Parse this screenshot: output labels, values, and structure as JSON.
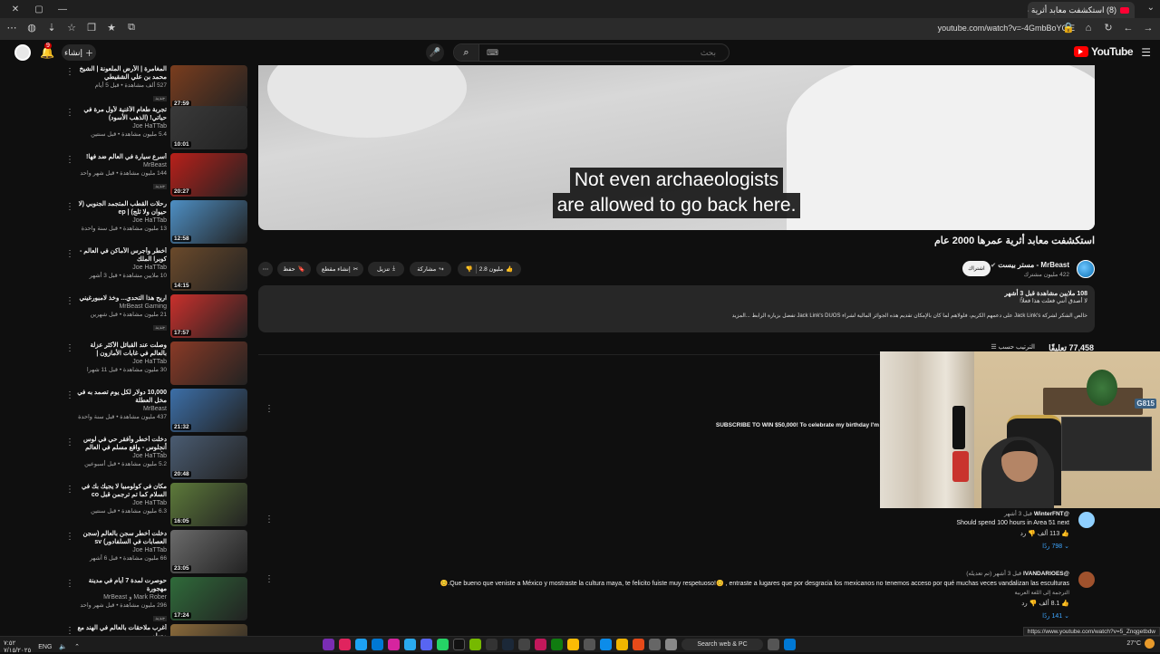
{
  "browser": {
    "tab_title": "(8) استكشفت معابد أثرية عمرها",
    "url": "youtube.com/watch?v=-4GmbBoYCjE",
    "status_url": "https://www.youtube.com/watch?v=5_Znqgetbdw"
  },
  "header": {
    "create_label": "إنشاء",
    "search_placeholder": "بحث",
    "notif_count": "9",
    "logo_text": "YouTube"
  },
  "related": [
    {
      "title": "المغامرة | الأرض الملعونة | الشيخ محمد بن علي الشقيطي",
      "channel": "",
      "meta": "527 ألف مشاهدة • قبل 5 أيام",
      "duration": "27:59",
      "new": "جديد",
      "thumb_color": "#7a3d1e"
    },
    {
      "title": "تجربة طعام الأغنية لأول مرة في حياتي! (الذهب الأسود)",
      "channel": "Joe HaTTab",
      "meta": "5.4 مليون مشاهدة • قبل سنتين",
      "duration": "10:01",
      "new": "",
      "thumb_color": "#3a3a3a"
    },
    {
      "title": "أسرع سيارة في العالم ضد فها!",
      "channel": "MrBeast",
      "meta": "144 مليون مشاهدة • قبل شهر واحد",
      "duration": "20:27",
      "new": "جديد",
      "thumb_color": "#b8201a"
    },
    {
      "title": "رحلات القطب المتجمد الجنوبي (لا حيوان ولا ثلج) | ep",
      "channel": "Joe HaTTab",
      "meta": "13 مليون مشاهدة • قبل سنة واحدة",
      "duration": "12:58",
      "new": "",
      "thumb_color": "#4e8fc4"
    },
    {
      "title": "أخطر وأجرس الأماكن في العالم - كوبرا الملك",
      "channel": "Joe HaTTab",
      "meta": "10 ملايين مشاهدة • قبل 3 أشهر",
      "duration": "14:15",
      "new": "",
      "thumb_color": "#6b4a2b"
    },
    {
      "title": "اربح هذا التحدي... وخذ لامبورغيني",
      "channel": "MrBeast Gaming",
      "meta": "21 مليون مشاهدة • قبل شهرين",
      "duration": "17:57",
      "new": "جديد",
      "thumb_color": "#c9302c"
    },
    {
      "title": "وصلت عند القبائل الأكثر عزلة بالعالم في غابات الأمازون | Waorani Tribe",
      "channel": "Joe HaTTab",
      "meta": "30 مليون مشاهدة • قبل 11 شهرا",
      "duration": "",
      "new": "",
      "thumb_color": "#8a3a26"
    },
    {
      "title": "10,000 دولار لكل يوم تصمد به في مخل العطلة",
      "channel": "MrBeast",
      "meta": "437 مليون مشاهدة • قبل سنة واحدة",
      "duration": "21:32",
      "new": "",
      "thumb_color": "#3c6fa8"
    },
    {
      "title": "دخلت أخطر وأفقر حي في لوس أنجلوس - واقع مسلم في العالم الأمريكي us",
      "channel": "Joe HaTTab",
      "meta": "5.2 مليون مشاهدة • قبل أسبوعين",
      "duration": "20:48",
      "new": "",
      "thumb_color": "#4a5c72"
    },
    {
      "title": "مكان في كولومبيا لا يجيك بك في السلام كما تم ترجمن قبل co",
      "channel": "Joe HaTTab",
      "meta": "6.3 مليون مشاهدة • قبل سنتين",
      "duration": "16:05",
      "new": "",
      "thumb_color": "#5d7a3a"
    },
    {
      "title": "دخلت أخطر سجن بالعالم (سجن العصابات في السلفادور) sv CECOT",
      "channel": "Joe HaTTab",
      "meta": "66 مليون مشاهدة • قبل 6 أشهر",
      "duration": "23:05",
      "new": "",
      "thumb_color": "#6b6b6b"
    },
    {
      "title": "حوصرت لمدة 7 أيام في مدينة مهجورة",
      "channel": "Mark Rober و MrBeast",
      "meta": "296 مليون مشاهدة • قبل شهر واحد",
      "duration": "17:24",
      "new": "جديد",
      "thumb_color": "#2f6b3a"
    },
    {
      "title": "أغرب ملاحقات بالعالم في الهند مع مسلم",
      "channel": "",
      "meta": "",
      "duration": "",
      "new": "",
      "thumb_color": "#8a6a3a"
    }
  ],
  "video": {
    "subtitle_line1": "Not even archaeologists",
    "subtitle_line2": "are allowed to go back here.",
    "title": "استكشفت معابد أثرية عمرها 2000 عام",
    "tag": "",
    "channel": "MrBeast - مستر بيست",
    "subs": "422 مليون مشترك",
    "subscribe_label": "اشتراك",
    "likes": "2.8 مليون",
    "share_label": "مشاركة",
    "download_label": "تنزيل",
    "clip_label": "إنشاء مقطع",
    "save_label": "حفظ"
  },
  "description": {
    "line1": "108 ملايين مشاهدة  قبل 3 أشهر",
    "line2": "لا أصدق أنني فعلت هذا فعلاً!",
    "line3": "خالص الشكر لشركة Jack Link's على دعمهم الكريم، فلولاهم لما كان بالإمكان تقديم هذه الجوائز المالية لشراء Jack Link's DUOS تفضل بزيارة الرابط ...المزيد"
  },
  "comments_header": {
    "count": "77,458 تعليقًا",
    "sort": "الترتيب حسب"
  },
  "promo_text": "SUBSCRIBE TO WIN $50,000! To celebrate my birthday I'm",
  "comments": [
    {
      "author": "@WinterFNT",
      "time": "قبل 3 أشهر",
      "body": "Should spend 100 hours in Area 51 next",
      "likes": "113 ألف",
      "replies": "798 ردًا",
      "translate": "",
      "avatar_color": "#8fd0ff"
    },
    {
      "author": "@IVANDARIOES",
      "time": "قبل 3 أشهر (تم تعديله)",
      "body": "Que bueno que veniste a México y mostraste la cultura maya, te felicito fuiste muy respetuoso!😊 , entraste a lugares que por desgracia los mexicanos no tenemos acceso por qué muchas veces vandalizan las esculturas.😊",
      "likes": "8.1 ألف",
      "replies": "141 ردًا",
      "translate": "الترجمة إلى اللغة العربية",
      "avatar_color": "#a0522d"
    }
  ],
  "taskbar": {
    "time": "٧:٥٢ م",
    "date": "٧/١٥/٢٠٢٥",
    "lang": "ENG",
    "search_label": "Search web & PC",
    "weather": "27°C",
    "clock_left": "٧:٥٢",
    "date_left": "٧/١٥/٢٠٢٥"
  }
}
